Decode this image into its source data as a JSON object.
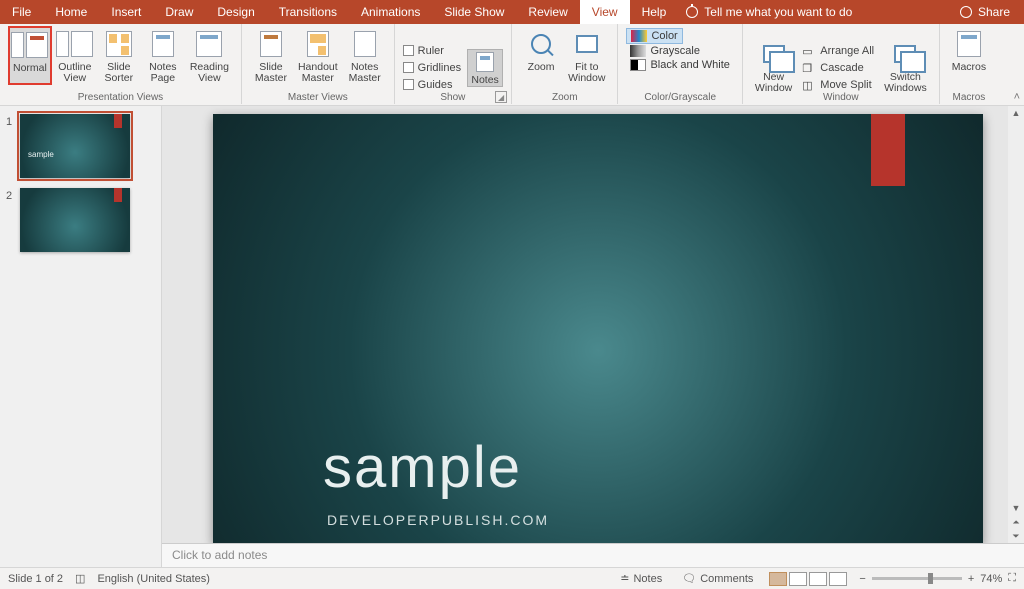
{
  "menu": {
    "tabs": [
      "File",
      "Home",
      "Insert",
      "Draw",
      "Design",
      "Transitions",
      "Animations",
      "Slide Show",
      "Review",
      "View",
      "Help"
    ],
    "active_index": 9,
    "tell_me": "Tell me what you want to do",
    "share": "Share"
  },
  "ribbon": {
    "presentation_views": {
      "label": "Presentation Views",
      "normal": "Normal",
      "outline": "Outline\nView",
      "sorter": "Slide\nSorter",
      "notes_page": "Notes\nPage",
      "reading": "Reading\nView"
    },
    "master_views": {
      "label": "Master Views",
      "slide_master": "Slide\nMaster",
      "handout_master": "Handout\nMaster",
      "notes_master": "Notes\nMaster"
    },
    "show": {
      "label": "Show",
      "ruler": "Ruler",
      "gridlines": "Gridlines",
      "guides": "Guides",
      "notes": "Notes"
    },
    "zoom": {
      "label": "Zoom",
      "zoom": "Zoom",
      "fit": "Fit to\nWindow"
    },
    "color_grayscale": {
      "label": "Color/Grayscale",
      "color": "Color",
      "grayscale": "Grayscale",
      "bw": "Black and White"
    },
    "window": {
      "label": "Window",
      "new_window": "New\nWindow",
      "arrange_all": "Arrange All",
      "cascade": "Cascade",
      "move_split": "Move Split",
      "switch": "Switch\nWindows"
    },
    "macros": {
      "label": "Macros",
      "macros": "Macros"
    }
  },
  "thumbs": [
    {
      "n": "1",
      "title": "sample"
    },
    {
      "n": "2",
      "title": ""
    }
  ],
  "slide": {
    "title": "sample",
    "subtitle": "DEVELOPERPUBLISH.COM"
  },
  "notes_placeholder": "Click to add notes",
  "status": {
    "slide_counter": "Slide 1 of 2",
    "language": "English (United States)",
    "notes": "Notes",
    "comments": "Comments",
    "zoom_pct": "74%"
  }
}
